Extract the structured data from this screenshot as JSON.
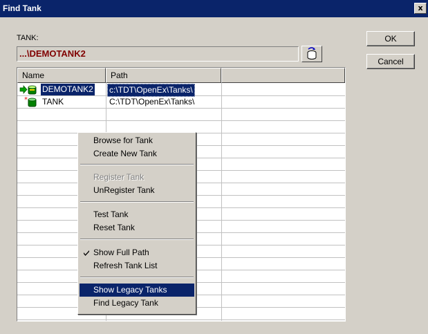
{
  "window": {
    "title": "Find Tank",
    "close_label": "x"
  },
  "tank": {
    "label": "TANK:",
    "value": "...\\DEMOTANK2"
  },
  "buttons": {
    "ok": "OK",
    "cancel": "Cancel"
  },
  "list": {
    "columns": [
      "Name",
      "Path"
    ],
    "rows": [
      {
        "name": "DEMOTANK2",
        "path": "c:\\TDT\\OpenEx\\Tanks\\",
        "selected": true
      },
      {
        "name": "TANK",
        "path": "C:\\TDT\\OpenEx\\Tanks\\",
        "selected": false
      }
    ]
  },
  "context_menu": {
    "items": [
      {
        "label": "Browse for Tank"
      },
      {
        "label": "Create New Tank"
      },
      {
        "label": "Register Tank",
        "disabled": true
      },
      {
        "label": "UnRegister Tank"
      },
      {
        "label": "Test Tank"
      },
      {
        "label": "Reset Tank"
      },
      {
        "label": "Show Full Path",
        "checked": true
      },
      {
        "label": "Refresh Tank List"
      },
      {
        "label": "Show Legacy Tanks",
        "highlighted": true
      },
      {
        "label": "Find Legacy Tank"
      }
    ]
  },
  "colors": {
    "titlebar": "#0a246a",
    "selection": "#0a246a",
    "dialog": "#d4d0c8",
    "tank_text": "#800000"
  }
}
